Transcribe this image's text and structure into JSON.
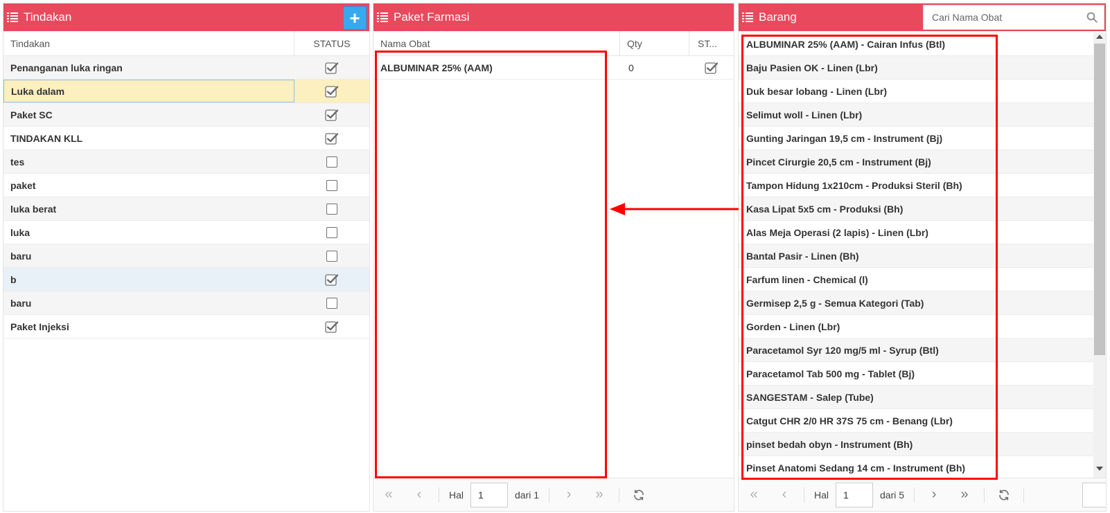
{
  "tindakan_panel": {
    "title": "Tindakan",
    "add_label": "+",
    "columns": {
      "name": "Tindakan",
      "status": "STATUS"
    },
    "rows": [
      {
        "name": "Penanganan luka ringan",
        "checked": true
      },
      {
        "name": "Luka dalam",
        "checked": true,
        "selected": true
      },
      {
        "name": "Paket SC",
        "checked": true
      },
      {
        "name": "TINDAKAN KLL",
        "checked": true
      },
      {
        "name": "tes",
        "checked": false
      },
      {
        "name": "paket",
        "checked": false
      },
      {
        "name": "luka berat",
        "checked": false
      },
      {
        "name": "luka",
        "checked": false
      },
      {
        "name": "baru",
        "checked": false
      },
      {
        "name": "b",
        "checked": true,
        "hover": true
      },
      {
        "name": "baru",
        "checked": false
      },
      {
        "name": "Paket Injeksi",
        "checked": true
      }
    ]
  },
  "paket_panel": {
    "title": "Paket Farmasi",
    "columns": {
      "name": "Nama Obat",
      "qty": "Qty",
      "status": "ST..."
    },
    "rows": [
      {
        "name": "ALBUMINAR 25% (AAM)",
        "qty": "0",
        "checked": true
      }
    ],
    "pager": {
      "page_label": "Hal",
      "page_value": "1",
      "of_label": "dari 1"
    }
  },
  "barang_panel": {
    "title": "Barang",
    "search_placeholder": "Cari Nama Obat",
    "rows": [
      "ALBUMINAR 25% (AAM) - Cairan Infus (Btl)",
      "Baju Pasien OK - Linen (Lbr)",
      "Duk besar lobang - Linen (Lbr)",
      "Selimut woll - Linen (Lbr)",
      "Gunting Jaringan 19,5 cm - Instrument (Bj)",
      "Pincet Cirurgie 20,5 cm - Instrument (Bj)",
      "Tampon Hidung 1x210cm - Produksi Steril (Bh)",
      "Kasa Lipat 5x5 cm - Produksi (Bh)",
      "Alas Meja Operasi (2 lapis) - Linen (Lbr)",
      "Bantal Pasir - Linen (Bh)",
      "Farfum linen - Chemical (l)",
      "Germisep 2,5 g - Semua Kategori (Tab)",
      "Gorden - Linen (Lbr)",
      "Paracetamol Syr 120 mg/5 ml - Syrup (Btl)",
      "Paracetamol Tab 500 mg - Tablet (Bj)",
      "SANGESTAM - Salep (Tube)",
      "Catgut CHR 2/0 HR 37S 75 cm - Benang (Lbr)",
      "pinset bedah obyn - Instrument (Bh)",
      "Pinset Anatomi Sedang 14 cm - Instrument (Bh)"
    ],
    "pager": {
      "page_label": "Hal",
      "page_value": "1",
      "of_label": "dari 5"
    }
  },
  "colors": {
    "header": "#e8495d",
    "add_button": "#38a9f0",
    "annotation": "#ff0000",
    "selected_row": "#fcefc0"
  }
}
